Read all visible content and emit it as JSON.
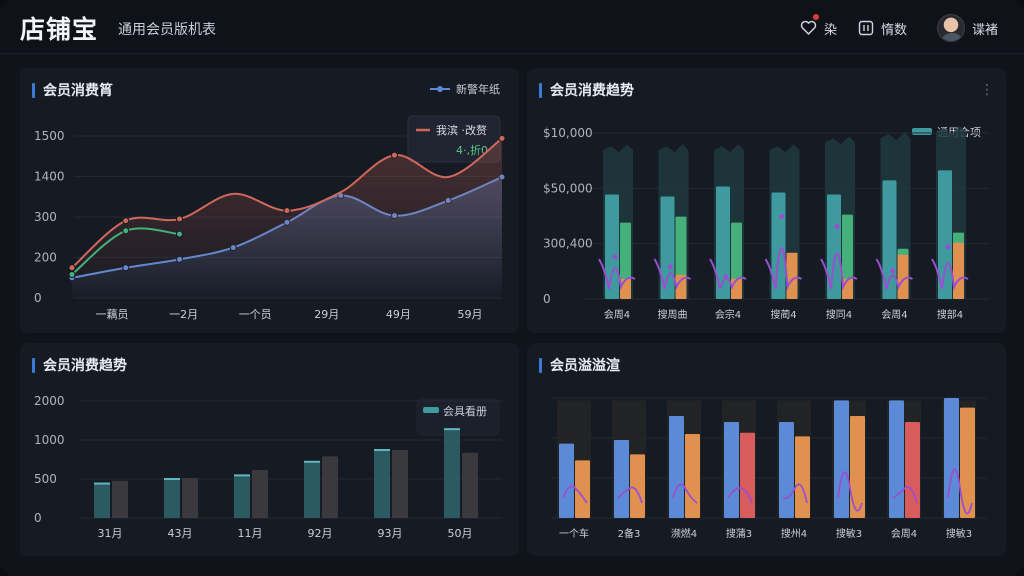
{
  "header": {
    "logo": "店铺宝",
    "subtitle": "通用会员版机表",
    "favorites_label": "染",
    "messages_label": "惰数",
    "user_name": "谍褚"
  },
  "panels": {
    "p1": {
      "title": "会员消费筲",
      "legend": "新警年纸",
      "tooltip_title": "我滨 ·改赘",
      "tooltip_value": "4·,折0"
    },
    "p2": {
      "title": "会员消费趋势",
      "legend": "通用合项"
    },
    "p3": {
      "title": "会员消费趋势",
      "legend": "会具看册"
    },
    "p4": {
      "title": "会员溢溢渲"
    }
  },
  "colors": {
    "accent": "#3a7bd5",
    "blue": "#5b8bd6",
    "orange": "#e0914f",
    "red": "#d95c5c",
    "green": "#45b07a",
    "teal": "#3f9a9f",
    "purple": "#9a4fd0"
  },
  "chart_data": [
    {
      "type": "line",
      "title": "会员消费筲",
      "y_ticks": [
        "1500",
        "1400",
        "300",
        "200",
        "0"
      ],
      "categories": [
        "一藕员",
        "一2月",
        "一个员",
        "29月",
        "49月",
        "59月"
      ],
      "series": [
        {
          "name": "新警年纸",
          "color": "#5b8bd6",
          "values": [
            0.12,
            0.18,
            0.23,
            0.3,
            0.45,
            0.61,
            0.49,
            0.58,
            0.72
          ]
        },
        {
          "name": "我滨 ·改赘",
          "color": "#d0685a",
          "values": [
            0.18,
            0.46,
            0.47,
            0.62,
            0.52,
            0.63,
            0.85,
            0.72,
            0.95
          ]
        },
        {
          "color": "#45b07a",
          "values": [
            0.14,
            0.4,
            0.38
          ]
        }
      ]
    },
    {
      "type": "bar",
      "title": "会员消费趋势",
      "y_ticks": [
        "$10,000",
        "$50,000",
        "300,400",
        "0"
      ],
      "categories": [
        "会周4",
        "搜周曲",
        "会宗4",
        "搜蔺4",
        "搜同4",
        "会周4",
        "搜部4"
      ],
      "series": [
        {
          "name": "background",
          "color": "#1e3a3e",
          "values": [
            0.76,
            0.76,
            0.76,
            0.76,
            0.8,
            0.82,
            0.85
          ]
        },
        {
          "name": "通用合项",
          "color": "#3f9a9f",
          "values": [
            0.52,
            0.51,
            0.56,
            0.53,
            0.52,
            0.59,
            0.64
          ]
        },
        {
          "color": "#45b07a",
          "values": [
            0.38,
            0.41,
            0.38,
            0.22,
            0.42,
            0.25,
            0.33
          ]
        },
        {
          "color": "#e0914f",
          "values": [
            0.1,
            0.12,
            0.1,
            0.23,
            0.1,
            0.22,
            0.28
          ]
        },
        {
          "color": "#9a4fd0",
          "values": [
            0.25,
            0.2,
            0.15,
            0.45,
            0.4,
            0.18,
            0.3
          ]
        }
      ]
    },
    {
      "type": "bar",
      "title": "会员消费趋势",
      "y_ticks": [
        "2000",
        "1000",
        "500",
        "0"
      ],
      "categories": [
        "31月",
        "43月",
        "11月",
        "92月",
        "93月",
        "50月"
      ],
      "series": [
        {
          "name": "会具看册",
          "color": "#2c5a63",
          "values": [
            380,
            430,
            470,
            620,
            750,
            980
          ]
        },
        {
          "color": "#3a3a3e",
          "values": [
            410,
            440,
            530,
            680,
            750,
            720
          ]
        }
      ]
    },
    {
      "type": "bar",
      "title": "会员溢溢渲",
      "categories": [
        "一个车",
        "2备3",
        "濒燃4",
        "搜蒲3",
        "搜州4",
        "搜敏3",
        "会周4",
        "搜敏3"
      ],
      "series": [
        {
          "name": "background",
          "color": "#262626",
          "values": [
            0.98,
            0.98,
            0.98,
            0.98,
            0.98,
            0.98,
            0.98,
            0.98
          ]
        },
        {
          "color": "#5b8bd6",
          "values": [
            0.62,
            0.65,
            0.85,
            0.8,
            0.8,
            0.98,
            0.98,
            1.0
          ]
        },
        {
          "color": "#e0914f",
          "values": [
            0.48,
            0.53,
            0.7,
            0.71,
            0.68,
            0.85,
            0.8,
            0.92
          ]
        },
        {
          "color": "#9a4fd0",
          "values": [
            0.3,
            0.22,
            0.34,
            0.25,
            0.15,
            0.55,
            0.2,
            0.6
          ]
        }
      ]
    }
  ]
}
